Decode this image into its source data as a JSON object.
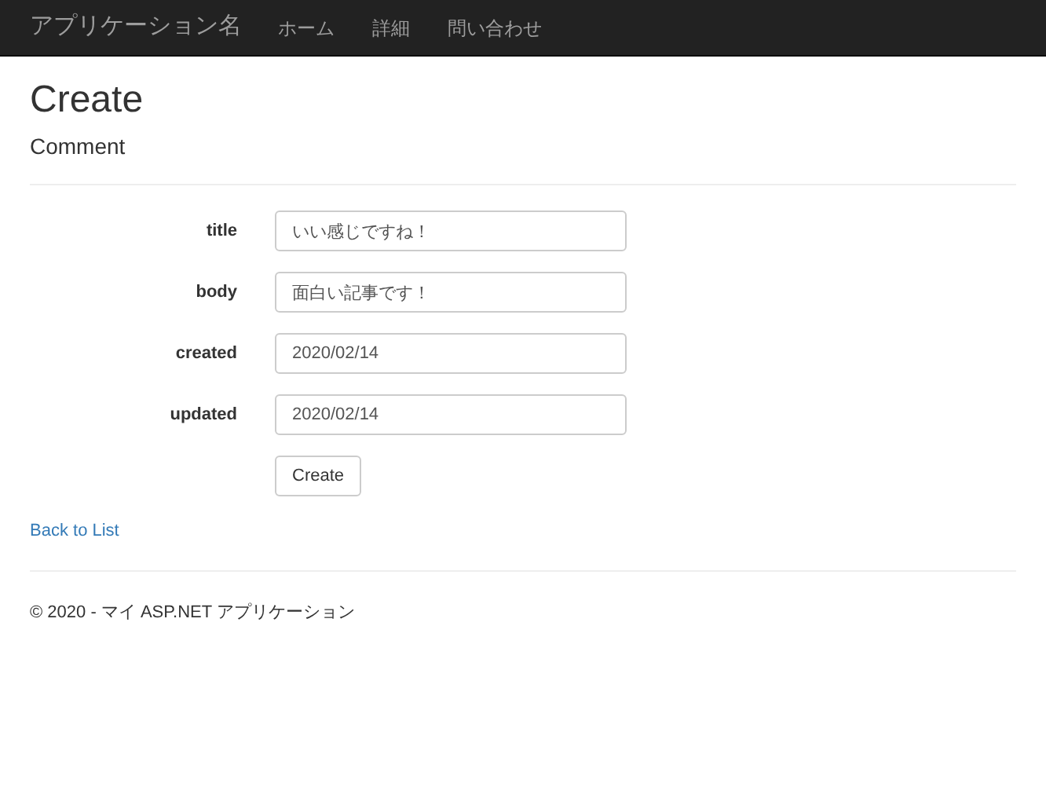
{
  "navbar": {
    "brand": "アプリケーション名",
    "links": [
      "ホーム",
      "詳細",
      "問い合わせ"
    ]
  },
  "heading": "Create",
  "subheading": "Comment",
  "form": {
    "fields": [
      {
        "label": "title",
        "value": "いい感じですね！"
      },
      {
        "label": "body",
        "value": "面白い記事です！"
      },
      {
        "label": "created",
        "value": "2020/02/14"
      },
      {
        "label": "updated",
        "value": "2020/02/14"
      }
    ],
    "submit": "Create"
  },
  "back_link": "Back to List",
  "footer": "© 2020 - マイ ASP.NET アプリケーション"
}
